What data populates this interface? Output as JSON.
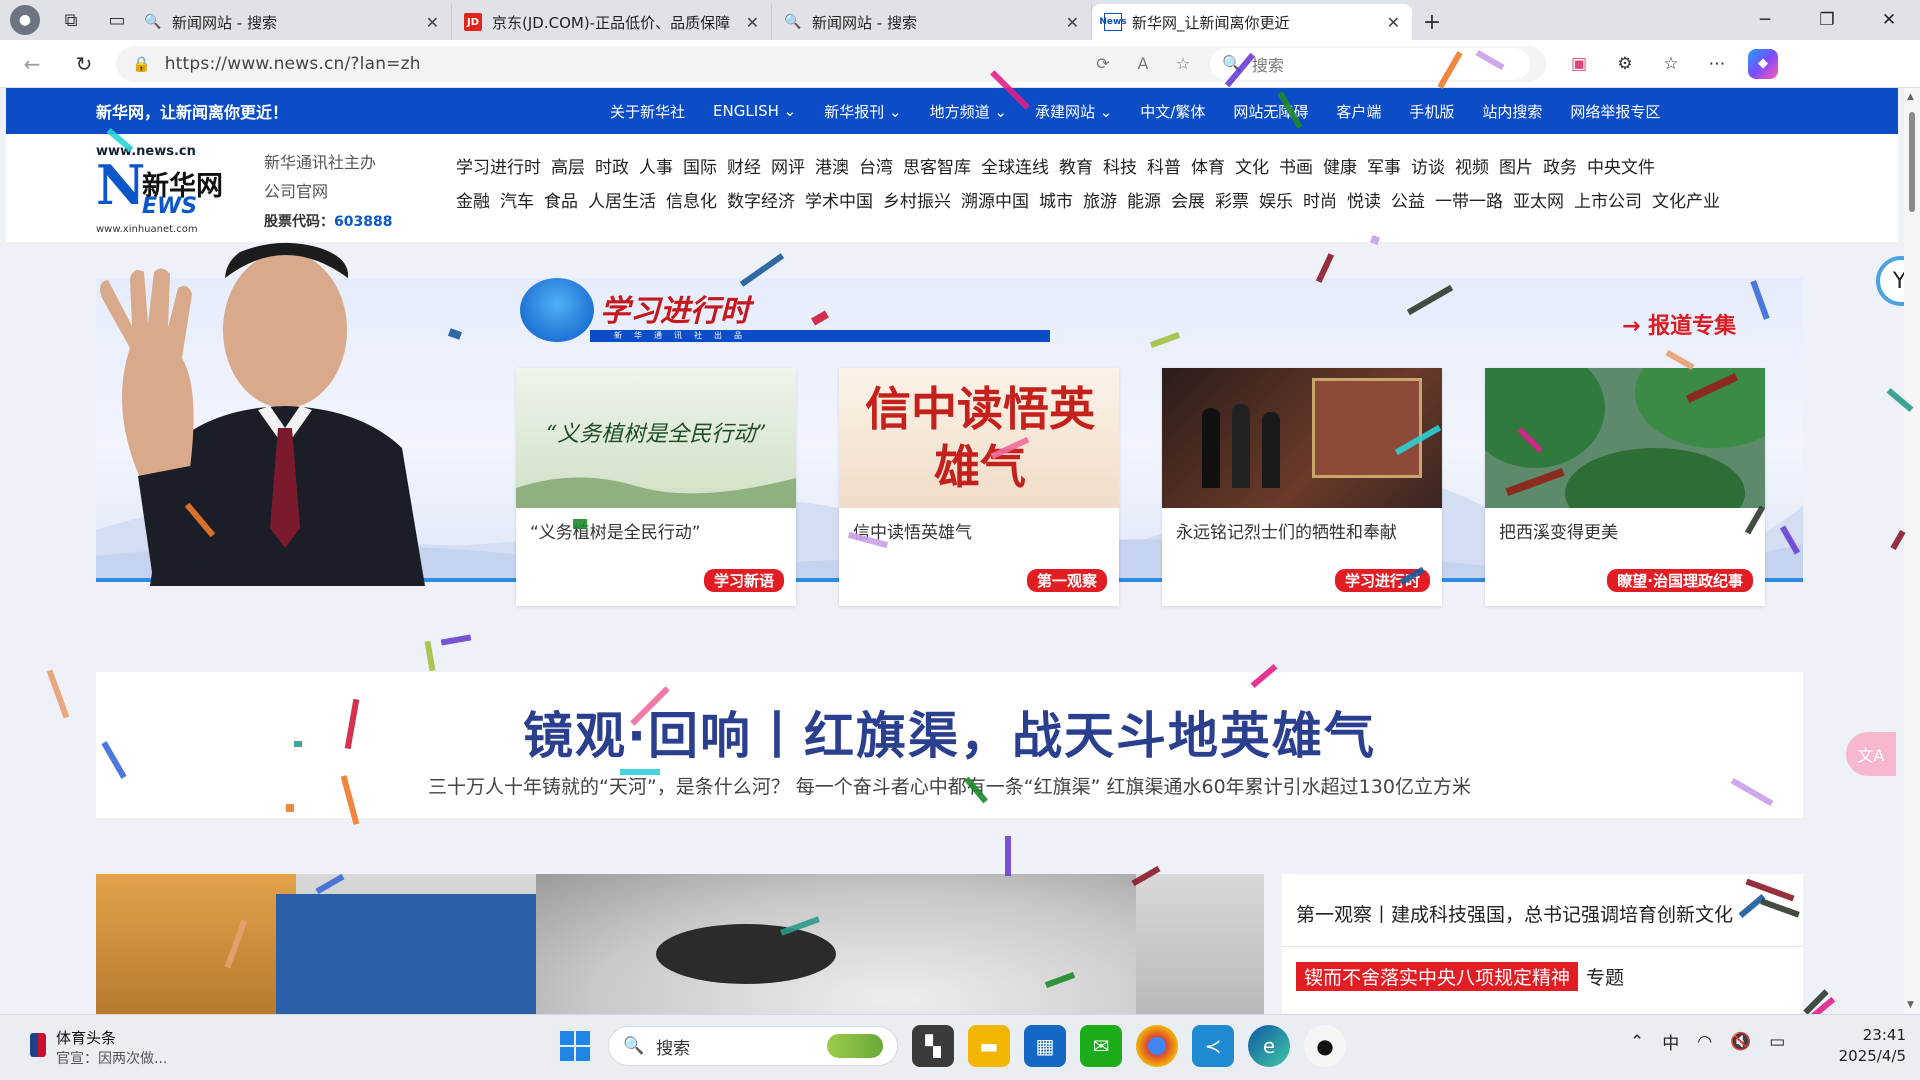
{
  "browser": {
    "tabs": [
      {
        "title": "新闻网站 - 搜索",
        "favicon": "search-icon"
      },
      {
        "title": "京东(JD.COM)-正品低价、品质保障",
        "favicon": "JD"
      },
      {
        "title": "新闻网站 - 搜索",
        "favicon": "search-icon"
      },
      {
        "title": "新华网_让新闻离你更近",
        "favicon": "News",
        "active": true
      }
    ],
    "url": "https://www.news.cn/?lan=zh",
    "search_placeholder": "搜索",
    "window_controls": [
      "─",
      "❐",
      "✕"
    ]
  },
  "site": {
    "slogan": "新华网，让新闻离你更近！",
    "top_nav": [
      "关于新华社",
      "ENGLISH ⌄",
      "新华报刊 ⌄",
      "地方频道 ⌄",
      "承建网站 ⌄",
      "中文/繁体",
      "网站无障碍",
      "客户端",
      "手机版",
      "站内搜索",
      "网络举报专区"
    ],
    "logo": {
      "domain": "www.news.cn",
      "name": "新华网",
      "mark": "NEWS",
      "sub": "www.xinhuanet.com"
    },
    "corp": {
      "line1": "新华通讯社主办",
      "line2": "公司官网",
      "code_label": "股票代码：",
      "code": "603888"
    },
    "channels_row1": [
      "学习进行时",
      "高层",
      "时政",
      "人事",
      "国际",
      "财经",
      "网评",
      "港澳",
      "台湾",
      "思客智库",
      "全球连线",
      "教育",
      "科技",
      "科普",
      "体育",
      "文化",
      "书画",
      "健康",
      "军事",
      "访谈",
      "视频",
      "图片",
      "政务",
      "中央文件"
    ],
    "channels_row2": [
      "金融",
      "汽车",
      "食品",
      "人居生活",
      "信息化",
      "数字经济",
      "学术中国",
      "乡村振兴",
      "溯源中国",
      "城市",
      "旅游",
      "能源",
      "会展",
      "彩票",
      "娱乐",
      "时尚",
      "悦读",
      "公益",
      "一带一路",
      "亚太网",
      "上市公司",
      "文化产业"
    ]
  },
  "banner": {
    "title": "学习进行时",
    "subtitle": "新华通讯社出品",
    "report_link": "→ 报道专集",
    "cards": [
      {
        "caption": "“义务植树是全民行动”",
        "tag": "学习新语",
        "image_text": "“义务植树是全民行动”"
      },
      {
        "caption": "信中读悟英雄气",
        "tag": "第一观察",
        "image_text": "信中读悟英雄气"
      },
      {
        "caption": "永远铭记烈士们的牺牲和奉献",
        "tag": "学习进行时",
        "image_text": ""
      },
      {
        "caption": "把西溪变得更美",
        "tag": "瞭望·治国理政纪事",
        "image_text": ""
      }
    ]
  },
  "headline": {
    "title": "镜观·回响丨红旗渠，战天斗地英雄气",
    "subtitle": "三十万人十年铸就的“天河”，是条什么河？ 每一个奋斗者心中都有一条“红旗渠” 红旗渠通水60年累计引水超过130亿立方米"
  },
  "side_news": {
    "item1": "第一观察丨建成科技强国，总书记强调培育创新文化",
    "item2_red": "锲而不舍落实中央八项规定精神",
    "item2_suffix": "专题"
  },
  "taskbar": {
    "news_title": "体育头条",
    "news_sub": "官宣：因两次做...",
    "search_label": "搜索",
    "ime": "中",
    "time": "23:41",
    "date": "2025/4/5"
  }
}
